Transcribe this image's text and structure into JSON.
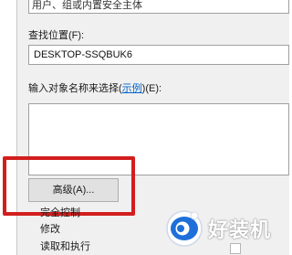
{
  "dialog": {
    "object_types_value": "用户、组或内置安全主体",
    "location_label": "查找位置(F):",
    "location_value": "DESKTOP-SSQBUK6",
    "names_label_prefix": "输入对象名称来选择(",
    "names_label_link": "示例",
    "names_label_suffix": ")(E):",
    "names_value": "",
    "advanced_button_label": "高级(A)..."
  },
  "permissions": {
    "items": [
      {
        "label": "完全控制"
      },
      {
        "label": "修改"
      },
      {
        "label": "读取和执行"
      }
    ]
  },
  "watermark": {
    "text": "好装机"
  },
  "colors": {
    "highlight_border": "#d31e1e",
    "link": "#0066cc",
    "dialog_bg": "#f0f0f0",
    "watermark_blue": "#1e6fd9"
  }
}
